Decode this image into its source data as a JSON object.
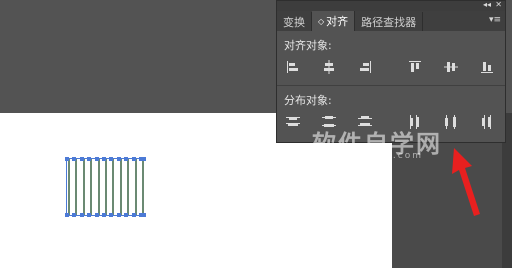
{
  "panel": {
    "tabs": [
      {
        "label": "变换"
      },
      {
        "label": "对齐",
        "arrows": "◇"
      },
      {
        "label": "路径查找器"
      }
    ],
    "collapse_glyph": "◂◂",
    "close_glyph": "✕",
    "menu_glyph": "▾≡",
    "align_label": "对齐对象:",
    "distribute_label": "分布对象:",
    "align_icons": [
      "align-left-icon",
      "align-horizontal-center-icon",
      "align-right-icon",
      "align-top-icon",
      "align-vertical-center-icon",
      "align-bottom-icon"
    ],
    "distribute_icons": [
      "distribute-top-icon",
      "distribute-vertical-center-icon",
      "distribute-bottom-icon",
      "distribute-left-icon",
      "distribute-horizontal-center-icon",
      "distribute-right-icon"
    ]
  },
  "watermark": {
    "title": "软件自学网",
    "url": "www.rjzxw.com"
  },
  "colors": {
    "workspace": "#535353",
    "artboard": "#ffffff",
    "selection": "#4c7ad6",
    "arrow": "#e8201f"
  }
}
